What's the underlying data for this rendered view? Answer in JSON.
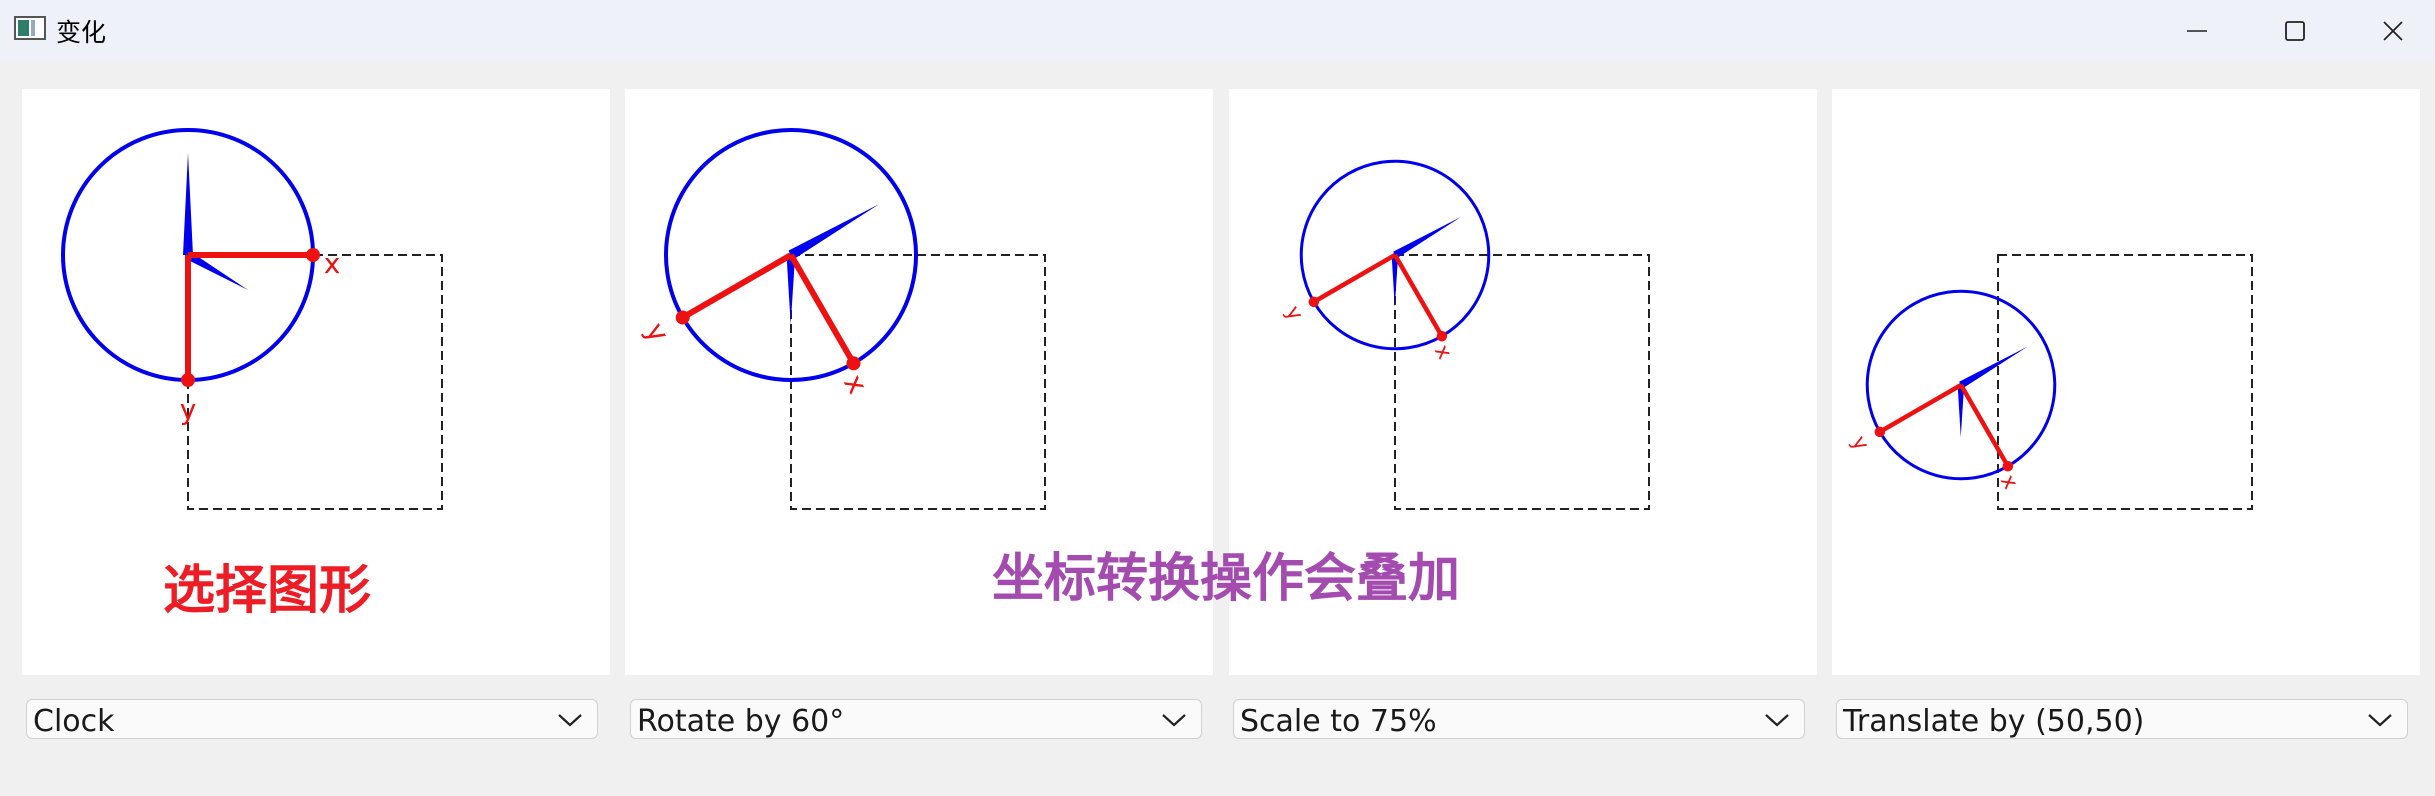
{
  "window": {
    "title": "变化"
  },
  "panels": [
    {
      "name": "clock",
      "x_label": "x",
      "y_label": "y"
    },
    {
      "name": "rotate",
      "x_label": "x",
      "y_label": "y"
    },
    {
      "name": "scale",
      "x_label": "x",
      "y_label": "y"
    },
    {
      "name": "translate",
      "x_label": "x",
      "y_label": "y"
    }
  ],
  "combos": [
    {
      "value": "Clock"
    },
    {
      "value": "Rotate by 60°"
    },
    {
      "value": "Scale to 75%"
    },
    {
      "value": "Translate by (50,50)"
    }
  ],
  "annotations": {
    "select_shape": "选择图形",
    "transforms_stack": "坐标转换操作会叠加"
  },
  "colors": {
    "circle": "#0000ee",
    "axes": "#ee1111",
    "annotation_red": "#ee1c24",
    "annotation_purple": "#a44bb0"
  }
}
